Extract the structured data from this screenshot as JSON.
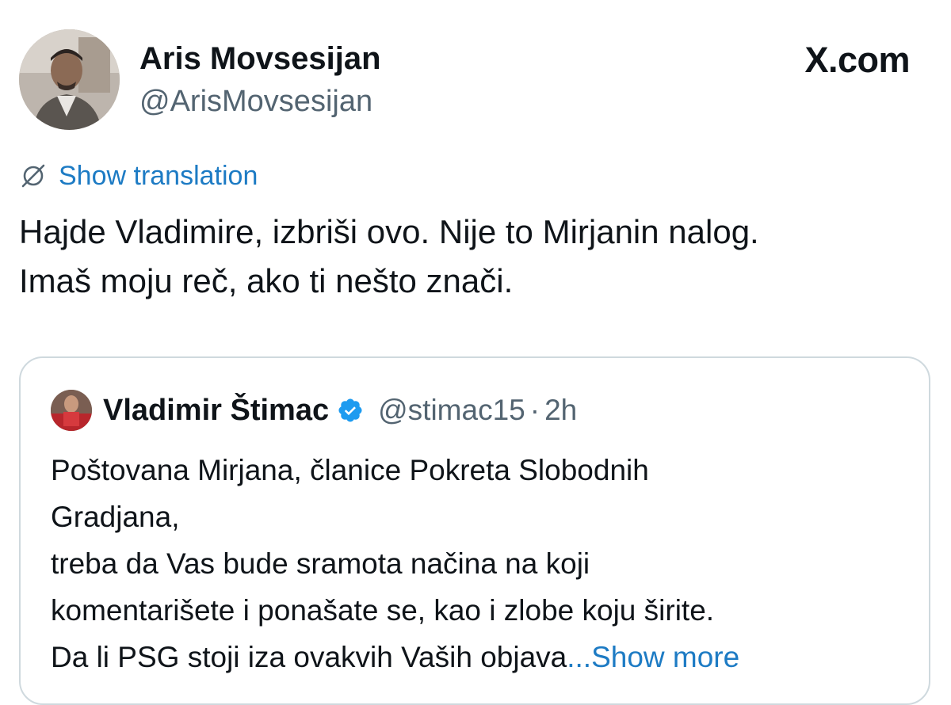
{
  "author": {
    "name": "Aris Movsesijan",
    "handle": "@ArisMovsesijan"
  },
  "brand": {
    "label": "X.com"
  },
  "translation": {
    "label": "Show translation",
    "icon": "globe-slash-icon"
  },
  "tweet": {
    "lines": [
      "Hajde Vladimire, izbriši ovo. Nije to Mirjanin nalog.",
      "Imaš moju reč, ako ti nešto znači."
    ]
  },
  "quote": {
    "name": "Vladimir Štimac",
    "verified_icon": "verified-badge-icon",
    "handle": "@stimac15",
    "separator": "·",
    "time": "2h",
    "lines": [
      "Poštovana Mirjana, članice Pokreta Slobodnih",
      "Gradjana,",
      "treba da Vas bude sramota načina na koji",
      "komentarišete i ponašate se, kao i zlobe koju širite.",
      "Da li PSG stoji iza ovakvih Vaših objava"
    ],
    "ellipsis": "...",
    "show_more": "Show more"
  },
  "colors": {
    "link": "#1d7bc4",
    "muted": "#536471",
    "verified": "#1d9bf0",
    "border": "#cfd9de"
  }
}
